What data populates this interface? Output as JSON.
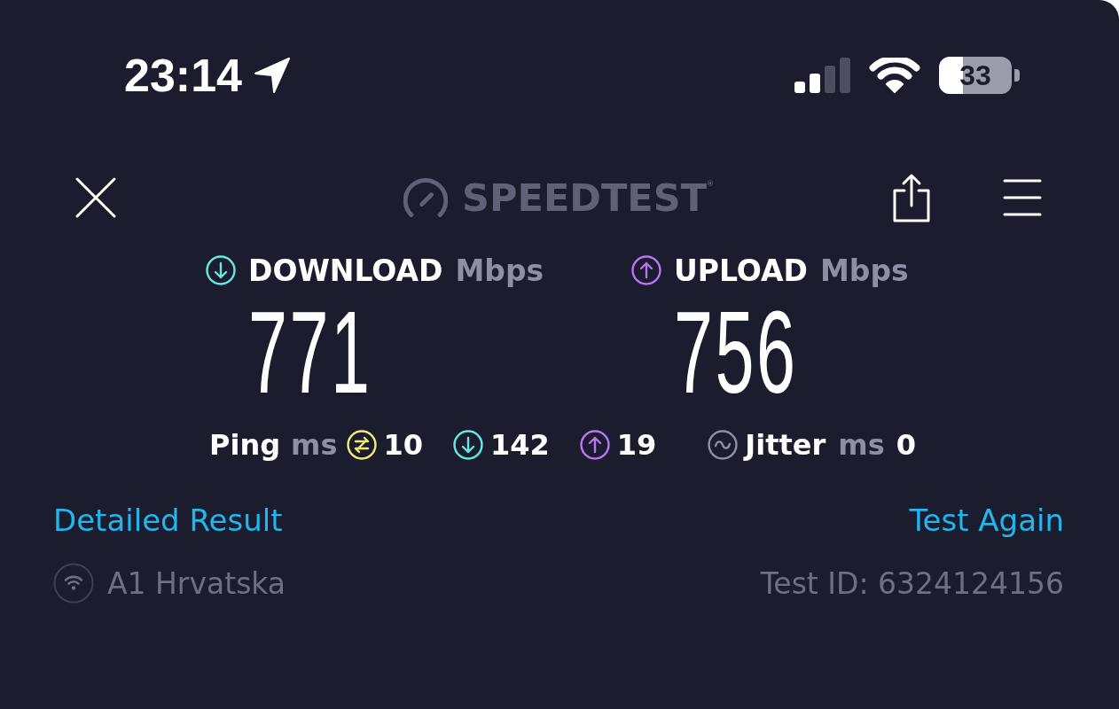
{
  "status_bar": {
    "time": "23:14",
    "battery": "33"
  },
  "header": {
    "logo": "SPEEDTEST$^{®}$"
  },
  "results": [
    {
      "kind": "download",
      "label": "DOWNLOAD",
      "unit": "Mbps",
      "value": "771"
    },
    {
      "kind": "upload",
      "label": "UPLOAD",
      "unit": "Mbps",
      "value": "756"
    }
  ],
  "ping": {
    "label": "Ping",
    "unit": "ms",
    "values": [
      {
        "kind": "idle",
        "value": "10"
      },
      {
        "kind": "download",
        "value": "142"
      },
      {
        "kind": "upload",
        "value": "19"
      }
    ]
  },
  "jitter": {
    "label": "Jitter",
    "unit": "ms",
    "value": "0"
  },
  "links": {
    "detailed_result": "Detailed Result",
    "test_again": "Test Again"
  },
  "footer": {
    "provider": "A1 Hrvatska",
    "test_id": "Test ID: 6324124156"
  }
}
